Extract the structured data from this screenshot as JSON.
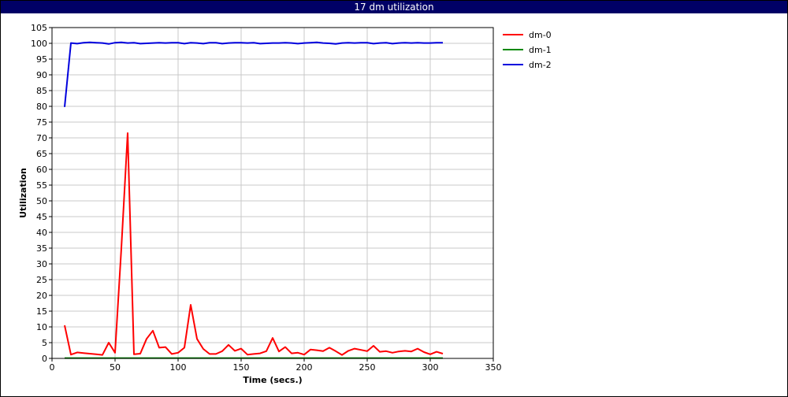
{
  "window": {
    "title": "17 dm utilization"
  },
  "chart_data": {
    "type": "line",
    "title": "17 dm utilization",
    "xlabel": "Time (secs.)",
    "ylabel": "Utilization",
    "xlim": [
      0,
      350
    ],
    "ylim": [
      0,
      105
    ],
    "xticks": [
      0,
      50,
      100,
      150,
      200,
      250,
      300,
      350
    ],
    "yticks": [
      0,
      5,
      10,
      15,
      20,
      25,
      30,
      35,
      40,
      45,
      50,
      55,
      60,
      65,
      70,
      75,
      80,
      85,
      90,
      95,
      100,
      105
    ],
    "grid": true,
    "legend_position": "top-right outside plot",
    "series": [
      {
        "name": "dm-0",
        "color": "#ff0000",
        "x": [
          10,
          15,
          20,
          25,
          30,
          35,
          40,
          45,
          50,
          55,
          60,
          65,
          70,
          75,
          80,
          85,
          90,
          95,
          100,
          105,
          110,
          115,
          120,
          125,
          130,
          135,
          140,
          145,
          150,
          155,
          160,
          165,
          170,
          175,
          180,
          185,
          190,
          195,
          200,
          205,
          210,
          215,
          220,
          225,
          230,
          235,
          240,
          245,
          250,
          255,
          260,
          265,
          270,
          275,
          280,
          285,
          290,
          295,
          300,
          305,
          310
        ],
        "values": [
          10.5,
          1.2,
          1.9,
          1.7,
          1.5,
          1.3,
          1.1,
          5.0,
          1.8,
          35.0,
          71.5,
          1.3,
          1.5,
          6.2,
          8.8,
          3.4,
          3.6,
          1.4,
          1.8,
          3.4,
          17.0,
          6.2,
          3.0,
          1.4,
          1.4,
          2.3,
          4.3,
          2.4,
          3.1,
          1.2,
          1.4,
          1.6,
          2.3,
          6.5,
          2.2,
          3.6,
          1.6,
          1.8,
          1.2,
          2.8,
          2.6,
          2.3,
          3.4,
          2.3,
          1.1,
          2.4,
          3.1,
          2.7,
          2.3,
          4.0,
          2.1,
          2.3,
          1.8,
          2.2,
          2.4,
          2.2,
          3.1,
          2.0,
          1.3,
          2.1,
          1.5
        ]
      },
      {
        "name": "dm-1",
        "color": "#008800",
        "x": [
          10,
          310
        ],
        "values": [
          0.1,
          0.1
        ]
      },
      {
        "name": "dm-2",
        "color": "#0000dd",
        "x": [
          10,
          15,
          20,
          25,
          30,
          35,
          40,
          45,
          50,
          55,
          60,
          65,
          70,
          75,
          80,
          85,
          90,
          95,
          100,
          105,
          110,
          115,
          120,
          125,
          130,
          135,
          140,
          145,
          150,
          155,
          160,
          165,
          170,
          175,
          180,
          185,
          190,
          195,
          200,
          205,
          210,
          215,
          220,
          225,
          230,
          235,
          240,
          245,
          250,
          255,
          260,
          265,
          270,
          275,
          280,
          285,
          290,
          295,
          300,
          305,
          310
        ],
        "values": [
          79.8,
          100.1,
          99.9,
          100.2,
          100.3,
          100.2,
          100.1,
          99.8,
          100.2,
          100.3,
          100.1,
          100.2,
          99.9,
          100.0,
          100.1,
          100.2,
          100.1,
          100.2,
          100.2,
          99.9,
          100.2,
          100.1,
          99.9,
          100.2,
          100.2,
          99.9,
          100.1,
          100.2,
          100.2,
          100.1,
          100.2,
          99.9,
          100.0,
          100.1,
          100.1,
          100.2,
          100.1,
          99.9,
          100.1,
          100.2,
          100.3,
          100.1,
          100.0,
          99.8,
          100.1,
          100.2,
          100.1,
          100.2,
          100.2,
          99.9,
          100.1,
          100.2,
          99.9,
          100.1,
          100.2,
          100.1,
          100.2,
          100.1,
          100.1,
          100.2,
          100.2
        ]
      }
    ]
  }
}
